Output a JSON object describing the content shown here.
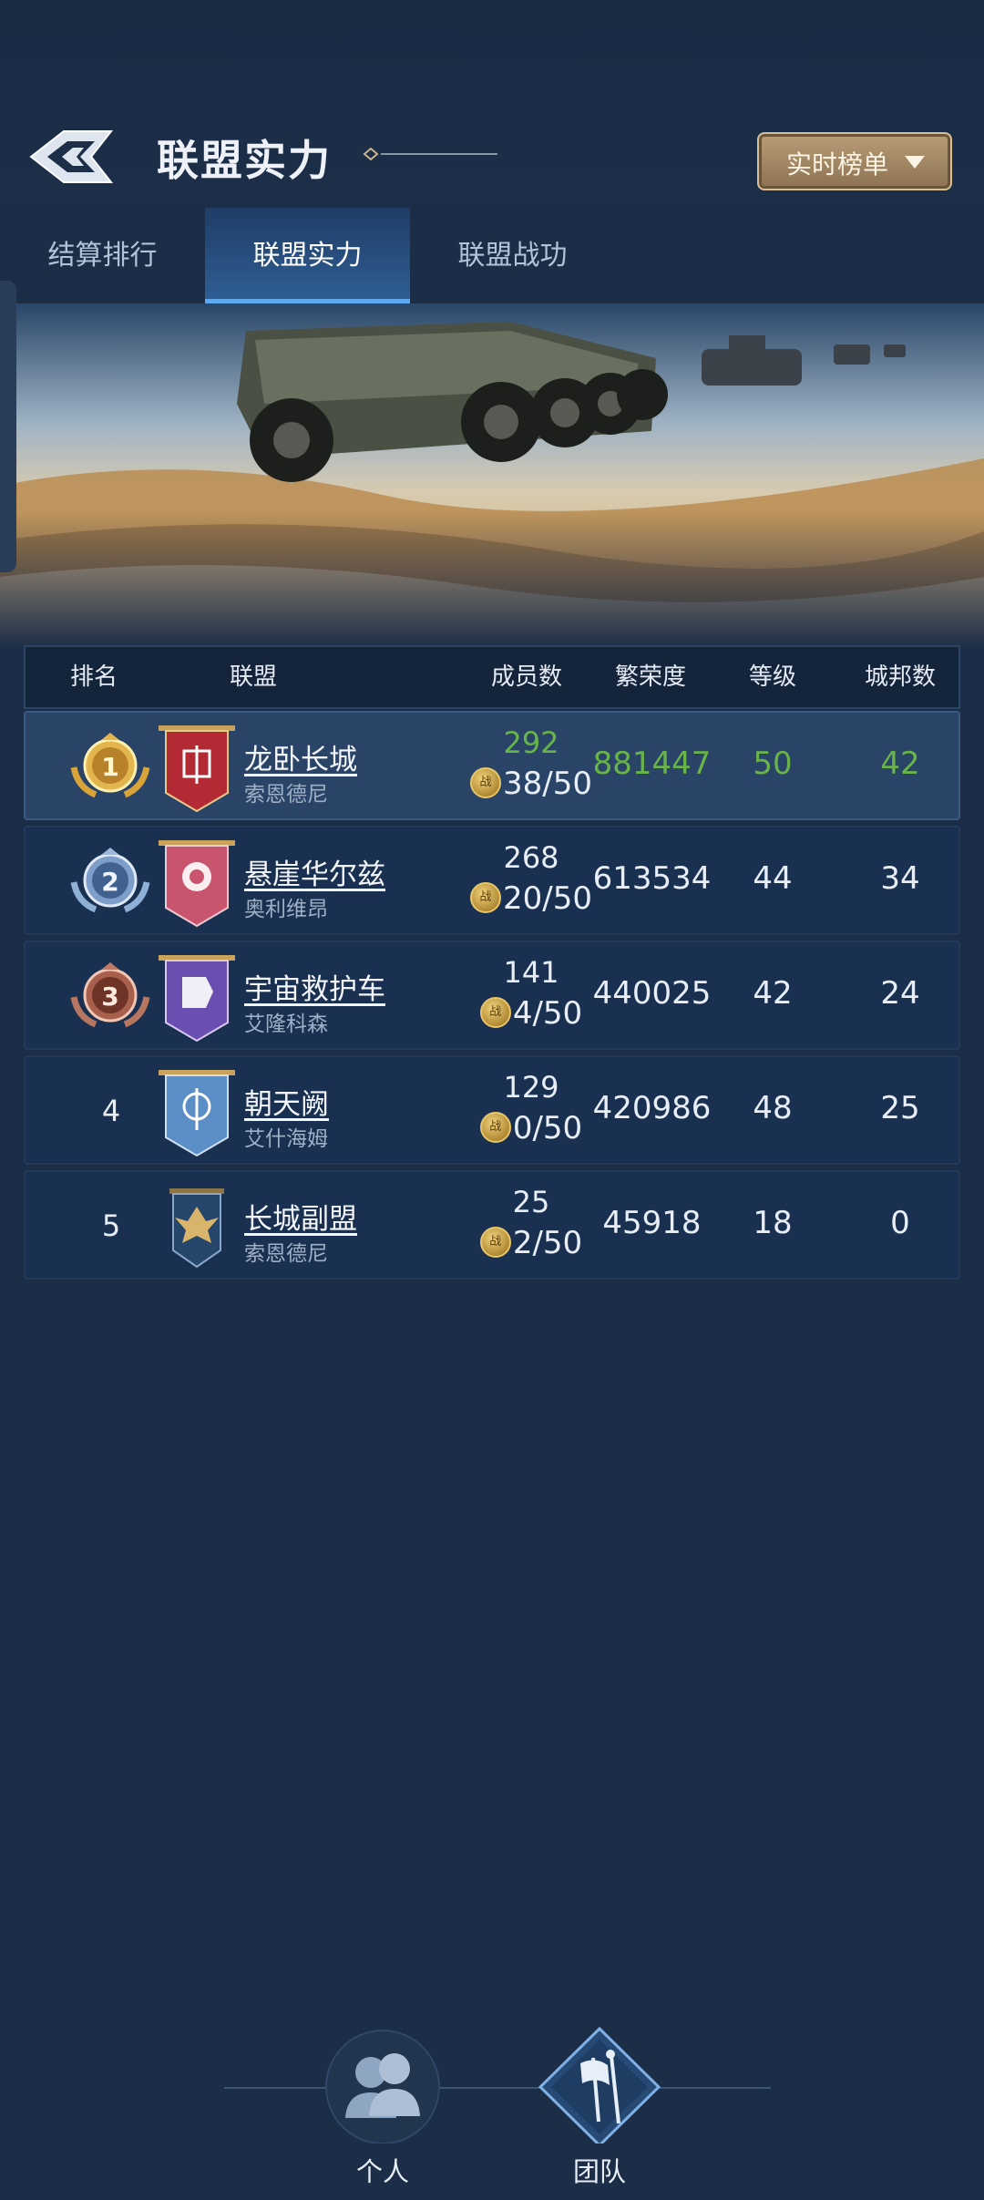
{
  "header": {
    "title": "联盟实力",
    "dropdown_label": "实时榜单"
  },
  "tabs": [
    {
      "label": "结算排行",
      "active": false
    },
    {
      "label": "联盟实力",
      "active": true
    },
    {
      "label": "联盟战功",
      "active": false
    }
  ],
  "table": {
    "columns": [
      "排名",
      "联盟",
      "成员数",
      "繁荣度",
      "等级",
      "城邦数"
    ],
    "rows": [
      {
        "rank": "1",
        "name": "龙卧长城",
        "server": "索恩德尼",
        "members": "292",
        "battle_members": "38/50",
        "prosperity": "881447",
        "level": "50",
        "cities": "42"
      },
      {
        "rank": "2",
        "name": "悬崖华尔兹",
        "server": "奥利维昂",
        "members": "268",
        "battle_members": "20/50",
        "prosperity": "613534",
        "level": "44",
        "cities": "34"
      },
      {
        "rank": "3",
        "name": "宇宙救护车",
        "server": "艾隆科森",
        "members": "141",
        "battle_members": "4/50",
        "prosperity": "440025",
        "level": "42",
        "cities": "24"
      },
      {
        "rank": "4",
        "name": "朝天阙",
        "server": "艾什海姆",
        "members": "129",
        "battle_members": "0/50",
        "prosperity": "420986",
        "level": "48",
        "cities": "25"
      },
      {
        "rank": "5",
        "name": "长城副盟",
        "server": "索恩德尼",
        "members": "25",
        "battle_members": "2/50",
        "prosperity": "45918",
        "level": "18",
        "cities": "0"
      }
    ]
  },
  "coin_glyph": "战",
  "bottom_nav": [
    {
      "label": "个人",
      "icon": "person-icon"
    },
    {
      "label": "团队",
      "icon": "team-flag-icon"
    }
  ],
  "colors": {
    "highlight": "#69b44a",
    "accent": "#5ea8f0",
    "dropdown": "#a88a63"
  }
}
